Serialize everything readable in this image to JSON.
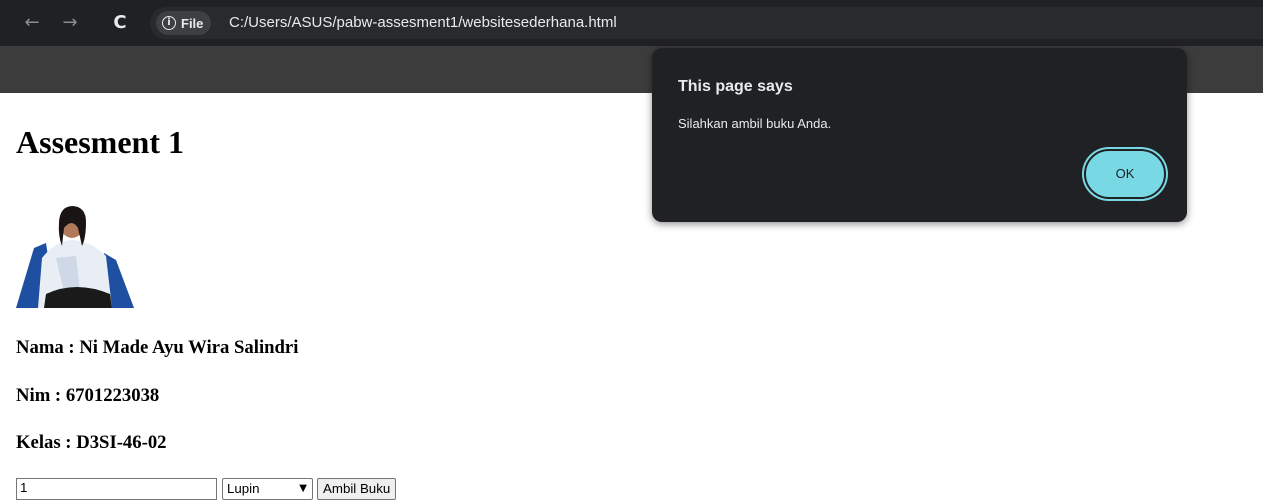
{
  "browser": {
    "site_chip_label": "File",
    "url": "C:/Users/ASUS/pabw-assesment1/websitesederhana.html",
    "icons": [
      "back-arrow-icon",
      "forward-arrow-icon",
      "reload-icon",
      "info-icon"
    ]
  },
  "page": {
    "title": "Assesment 1",
    "nama": "Nama : Ni Made Ayu Wira Salindri",
    "nim": "Nim : 6701223038",
    "kelas": "Kelas : D3SI-46-02",
    "form": {
      "quantity_value": "1",
      "book_selected": "Lupin",
      "submit_label": "Ambil Buku"
    }
  },
  "dialog": {
    "title": "This page says",
    "message": "Silahkan ambil buku Anda.",
    "ok_label": "OK",
    "accent_color": "#78d9e4"
  }
}
